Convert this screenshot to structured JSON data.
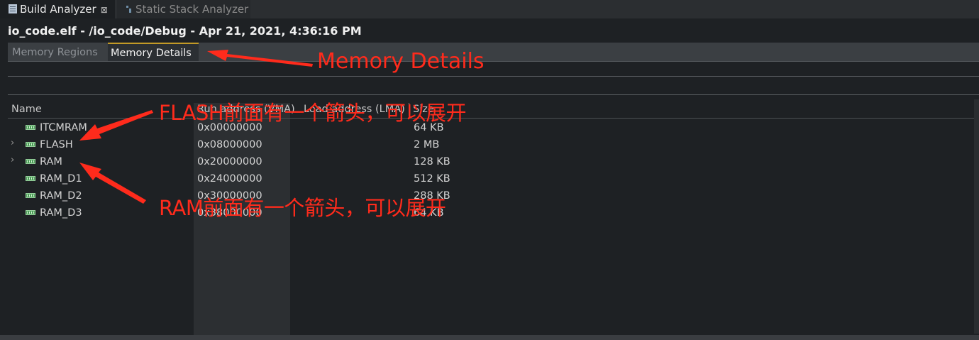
{
  "view_tabs": [
    {
      "label": "Build Analyzer",
      "icon": "analyzer-doc-icon",
      "close": "⊠"
    },
    {
      "label": "Static Stack Analyzer",
      "icon": "stack-analyzer-icon"
    }
  ],
  "title": "io_code.elf - /io_code/Debug - Apr 21, 2021, 4:36:16 PM",
  "sub_tabs": [
    {
      "label": "Memory Regions",
      "active": false
    },
    {
      "label": "Memory Details",
      "active": true
    }
  ],
  "table": {
    "columns": [
      "Name",
      "Run address (VMA)",
      "Load address (LMA)",
      "Size"
    ],
    "rows": [
      {
        "expandable": false,
        "name": "ITCMRAM",
        "run": "0x00000000",
        "size": "64 KB"
      },
      {
        "expandable": true,
        "name": "FLASH",
        "run": "0x08000000",
        "size": "2 MB"
      },
      {
        "expandable": true,
        "name": "RAM",
        "run": "0x20000000",
        "size": "128 KB"
      },
      {
        "expandable": false,
        "name": "RAM_D1",
        "run": "0x24000000",
        "size": "512 KB"
      },
      {
        "expandable": false,
        "name": "RAM_D2",
        "run": "0x30000000",
        "size": "288 KB"
      },
      {
        "expandable": false,
        "name": "RAM_D3",
        "run": "0x38000000",
        "size": "64 KB"
      }
    ]
  },
  "annotations": {
    "memory_details": "Memory Details",
    "flash_note": "FLASH前面有一个箭头，可以展开",
    "ram_note": "RAM前面有一个箭头，可以展开",
    "color": "#ff2b1c"
  },
  "colors": {
    "background": "#1e2124",
    "active_tab_accent": "#c29a27",
    "memory_icon": "#4ea05a"
  }
}
